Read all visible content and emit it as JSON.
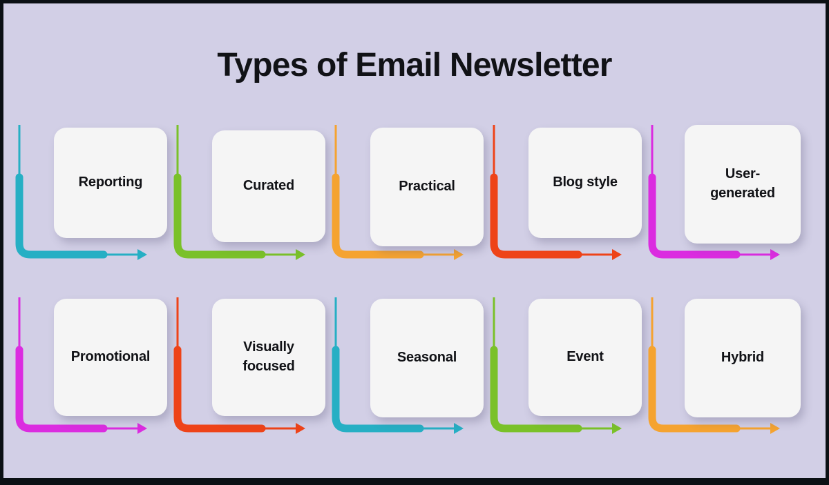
{
  "infographic": {
    "title": "Types of Email Newsletter",
    "background_color": "#D2CFE6",
    "frame_color": "#0B1014",
    "card_color": "#F5F5F5",
    "text_color": "#111216"
  },
  "palette": {
    "teal": "#26AFC4",
    "green": "#7AC129",
    "orange": "#F5A330",
    "red": "#EE4318",
    "magenta": "#DB2CE0"
  },
  "rows": [
    {
      "name": "row-1",
      "items": [
        {
          "label": "Reporting",
          "color": "#26AFC4",
          "color_name": "teal"
        },
        {
          "label": "Curated",
          "color": "#7AC129",
          "color_name": "green"
        },
        {
          "label": "Practical",
          "color": "#F5A330",
          "color_name": "orange"
        },
        {
          "label": "Blog style",
          "color": "#EE4318",
          "color_name": "red"
        },
        {
          "label": "User-\ngenerated",
          "color": "#DB2CE0",
          "color_name": "magenta"
        }
      ]
    },
    {
      "name": "row-2",
      "items": [
        {
          "label": "Promotional",
          "color": "#DB2CE0",
          "color_name": "magenta"
        },
        {
          "label": "Visually\nfocused",
          "color": "#EE4318",
          "color_name": "red"
        },
        {
          "label": "Seasonal",
          "color": "#26AFC4",
          "color_name": "teal"
        },
        {
          "label": "Event",
          "color": "#7AC129",
          "color_name": "green"
        },
        {
          "label": "Hybrid",
          "color": "#F5A330",
          "color_name": "orange"
        }
      ]
    }
  ]
}
